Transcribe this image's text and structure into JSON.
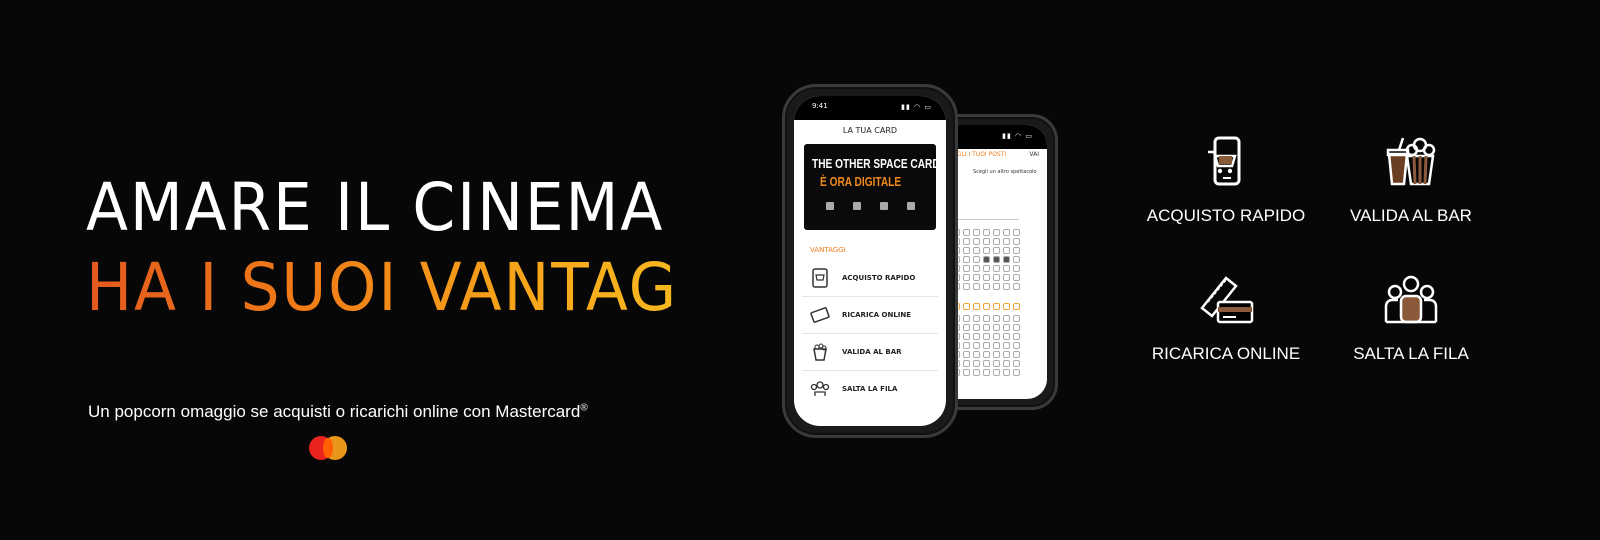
{
  "headline": {
    "line1": "AMARE IL CINEMA",
    "line2": "HA I SUOI VANTAGGI"
  },
  "promo": {
    "text": "Un popcorn omaggio se acquisti o ricarichi online con Mastercard",
    "reg": "®",
    "logo": "mastercard-logo"
  },
  "phone_front": {
    "time": "9:41",
    "title": "LA TUA CARD",
    "card_line1": "THE OTHER SPACE CARD",
    "card_line2": "È ORA DIGITALE",
    "section": "VANTAGGI",
    "items": [
      {
        "label": "ACQUISTO RAPIDO",
        "icon": "phone-cart-icon"
      },
      {
        "label": "RICARICA ONLINE",
        "icon": "ticket-card-icon"
      },
      {
        "label": "VALIDA AL BAR",
        "icon": "popcorn-icon"
      },
      {
        "label": "SALTA LA FILA",
        "icon": "people-icon"
      }
    ]
  },
  "phone_back": {
    "header": "SCEGLI I TUOI POSTI",
    "action": "VAI",
    "subtext": "Scegli un altro spettacolo"
  },
  "features": [
    {
      "label": "ACQUISTO RAPIDO",
      "icon": "phone-cart-icon"
    },
    {
      "label": "VALIDA AL BAR",
      "icon": "popcorn-drink-icon"
    },
    {
      "label": "RICARICA ONLINE",
      "icon": "ticket-card-icon"
    },
    {
      "label": "SALTA LA FILA",
      "icon": "people-icon"
    }
  ],
  "colors": {
    "background": "#070707",
    "accent_start": "#e2591f",
    "accent_end": "#f8b91f"
  }
}
